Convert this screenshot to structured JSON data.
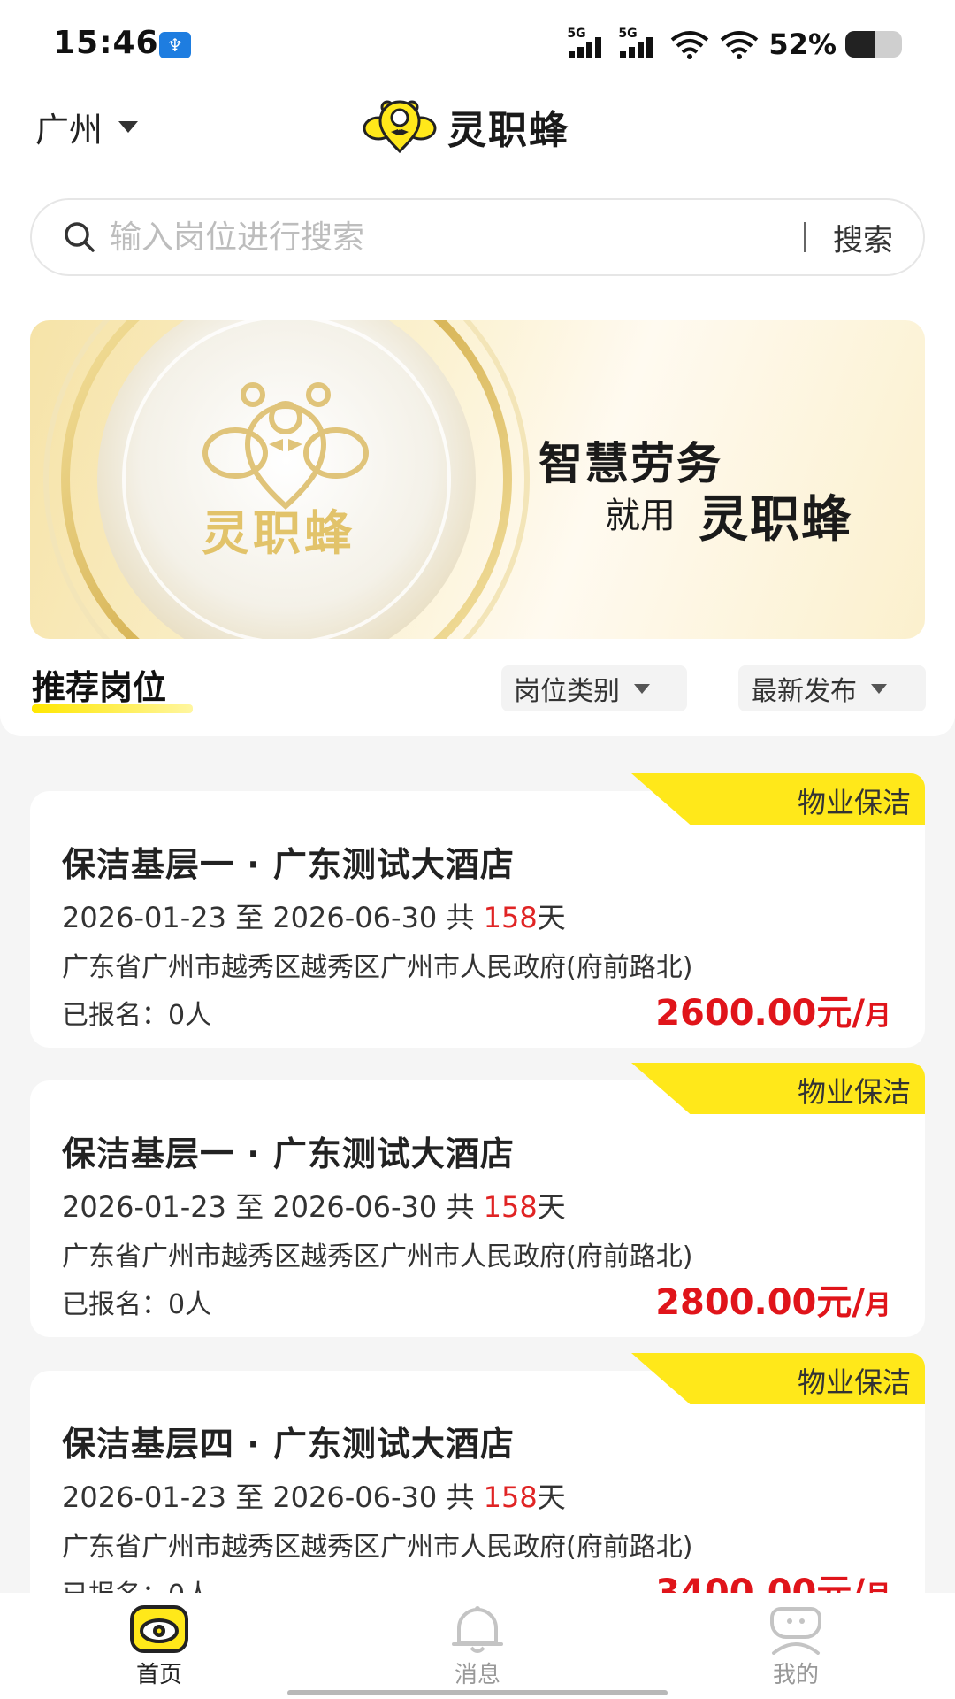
{
  "status_bar": {
    "time": "15:46",
    "signal_1": "5G",
    "signal_2": "5G",
    "battery_percent": "52%",
    "battery_level": 0.52
  },
  "header": {
    "city": "广州",
    "brand_name": "灵职蜂"
  },
  "search": {
    "placeholder": "输入岗位进行搜索",
    "button_label": "搜索"
  },
  "banner": {
    "logo_text": "灵职蜂",
    "slogan_line1": "智慧劳务",
    "slogan_line2_prefix": "就用",
    "slogan_line2_brand": "灵职蜂"
  },
  "section": {
    "title": "推荐岗位",
    "filter_category": "岗位类别",
    "filter_latest": "最新发布"
  },
  "jobs": [
    {
      "tag": "物业保洁",
      "title": "保洁基层一 · 广东测试大酒店",
      "date_range": "2026-01-23 至 2026-06-30 共 ",
      "days": "158",
      "days_unit": "天",
      "address": "广东省广州市越秀区越秀区广州市人民政府(府前路北)",
      "enrolled": "已报名：0人",
      "salary": "2600.00元/",
      "salary_unit": "月"
    },
    {
      "tag": "物业保洁",
      "title": "保洁基层一 · 广东测试大酒店",
      "date_range": "2026-01-23 至 2026-06-30 共 ",
      "days": "158",
      "days_unit": "天",
      "address": "广东省广州市越秀区越秀区广州市人民政府(府前路北)",
      "enrolled": "已报名：0人",
      "salary": "2800.00元/",
      "salary_unit": "月"
    },
    {
      "tag": "物业保洁",
      "title": "保洁基层四 · 广东测试大酒店",
      "date_range": "2026-01-23 至 2026-06-30 共 ",
      "days": "158",
      "days_unit": "天",
      "address": "广东省广州市越秀区越秀区广州市人民政府(府前路北)",
      "enrolled": "已报名：0人",
      "salary": "3400.00元/",
      "salary_unit": "月"
    }
  ],
  "bottom_nav": {
    "home": "首页",
    "messages": "消息",
    "mine": "我的"
  },
  "colors": {
    "accent_yellow": "#ffe81a",
    "salary_red": "#e0141a",
    "days_red": "#e02424"
  }
}
